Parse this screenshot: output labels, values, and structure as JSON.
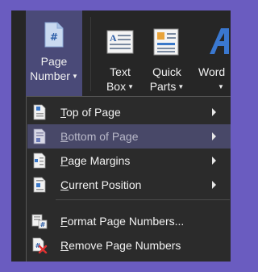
{
  "ribbon": {
    "page_number": {
      "line1": "Page",
      "line2": "Number",
      "icon": "page-number-icon"
    },
    "text_box": {
      "line1": "Text",
      "line2": "Box",
      "icon": "text-box-icon"
    },
    "quick_parts": {
      "line1": "Quick",
      "line2": "Parts",
      "icon": "quick-parts-icon"
    },
    "wordart": {
      "line1": "Word",
      "icon": "wordart-icon"
    }
  },
  "menu": {
    "items": [
      {
        "mnemonic": "T",
        "rest": "op of Page",
        "icon": "top-of-page-icon",
        "submenu": true
      },
      {
        "mnemonic": "B",
        "rest": "ottom of Page",
        "icon": "bottom-of-page-icon",
        "submenu": true
      },
      {
        "mnemonic": "P",
        "rest": "age Margins",
        "icon": "page-margins-icon",
        "submenu": true
      },
      {
        "mnemonic": "C",
        "rest": "urrent Position",
        "icon": "current-position-icon",
        "submenu": true
      },
      {
        "mnemonic": "F",
        "rest": "ormat Page Numbers...",
        "icon": "format-page-numbers-icon",
        "submenu": false
      },
      {
        "mnemonic": "R",
        "rest": "emove Page Numbers",
        "icon": "remove-page-numbers-icon",
        "submenu": false
      }
    ]
  },
  "colors": {
    "background": "#6a5cc0",
    "ribbon": "#262626",
    "active_button": "#4a4a78",
    "menu_hover": "#484868",
    "menu": "#2b2b2b"
  }
}
